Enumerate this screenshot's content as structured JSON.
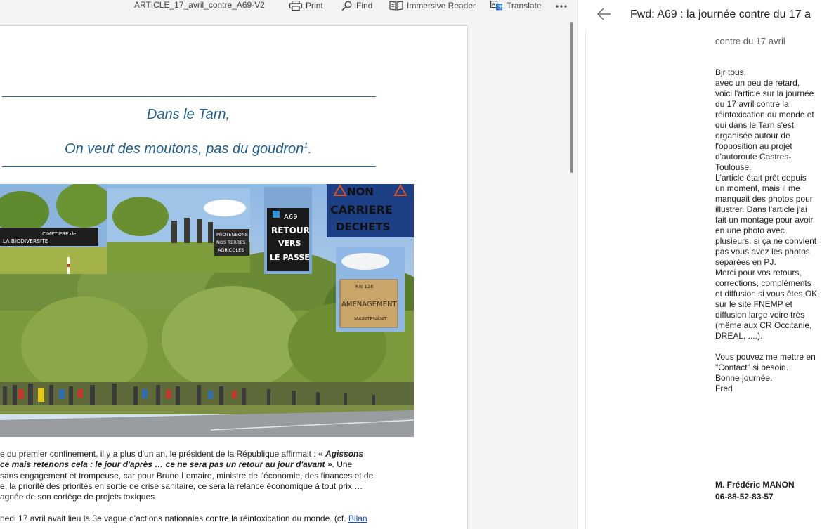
{
  "toolbar": {
    "document_name": "ARTICLE_17_avril_contre_A69-V2",
    "print_label": "Print",
    "find_label": "Find",
    "immersive_reader_label": "Immersive Reader",
    "translate_label": "Translate",
    "more_icon": "ellipsis-icon"
  },
  "article": {
    "heading_line_1": "Dans le Tarn,",
    "heading_line_2": "On veut des moutons, pas du goudron",
    "heading_footnote": "1",
    "heading_end": ".",
    "photo_signs": {
      "banner_cemetery_1": "CIMETIERE de",
      "banner_cemetery_2": "LA BIODIVERSITE",
      "sign_protect_1": "PROTEGEONS",
      "sign_protect_2": "NOS TERRES",
      "sign_protect_3": "AGRICOLES",
      "sign_a69_1": "A69",
      "sign_a69_2": "RETOUR",
      "sign_a69_3": "VERS",
      "sign_a69_4": "LE PASSE",
      "sign_non_1": "NON",
      "sign_non_2": "CARRIERE",
      "sign_non_3": "DECHETS",
      "sign_rn_1": "RN 126",
      "sign_rn_2": "AMENAGEMENT",
      "sign_rn_3": "MAINTENANT"
    },
    "para_1_line_1a": "e du premier confinement, il y a plus d'un an, le président de la République affirmait : « ",
    "para_1_line_1b": "Agissons",
    "para_1_line_2a": "ce mais retenons cela : le jour d'après … ce ne sera pas un retour au jour d'avant »",
    "para_1_line_2b": ". Une",
    "para_1_line_3": "sans engagement et trompeuse, car pour Bruno Lemaire, ministre de l'économie, des finances et de",
    "para_1_line_4": "e, la priorité des priorités en sortie de crise sanitaire, ce sera la relance économique à tout prix …",
    "para_1_line_5": "agnée de son cortège de projets toxiques.",
    "para_2_text": "nedi 17 avril avait lieu la 3e vague d'actions nationales contre la réintoxication du monde. (cf. ",
    "para_2_link": "Bilan"
  },
  "mail": {
    "back_icon": "arrow-left-icon",
    "subject": "Fwd: A69 : la journée contre du 17 a",
    "subject_tail": "contre du 17 avril",
    "body_lines": [
      "Bjr tous,",
      "avec un peu de retard,",
      "voici l'article sur la journée",
      "du 17 avril contre la",
      "réintoxication du monde et",
      "qui dans le Tarn s'est",
      "organisée autour de",
      "l'opposition au projet",
      "d'autoroute Castres-",
      "Toulouse.",
      "L'article était prêt depuis",
      "un moment, mais il me",
      "manquait des photos pour",
      "illustrer. Dans l'article j'ai",
      "fait un montage pour avoir",
      "en une photo avec",
      "plusieurs, si ça ne convient",
      "pas vous avez les photos",
      "séparées en PJ.",
      "Merci pour vos retours,",
      "corrections, compléments",
      "et diffusion si vous êtes OK",
      "sur le site FNEMP et",
      "diffusion large voire très",
      "(même aux CR Occitanie,",
      "DREAL, ....).",
      "",
      "Vous pouvez me mettre en",
      "\"Contact\" si besoin.",
      "Bonne journée.",
      "Fred"
    ],
    "signature_name": "M. Frédéric MANON",
    "signature_phone": "06-88-52-83-57"
  }
}
